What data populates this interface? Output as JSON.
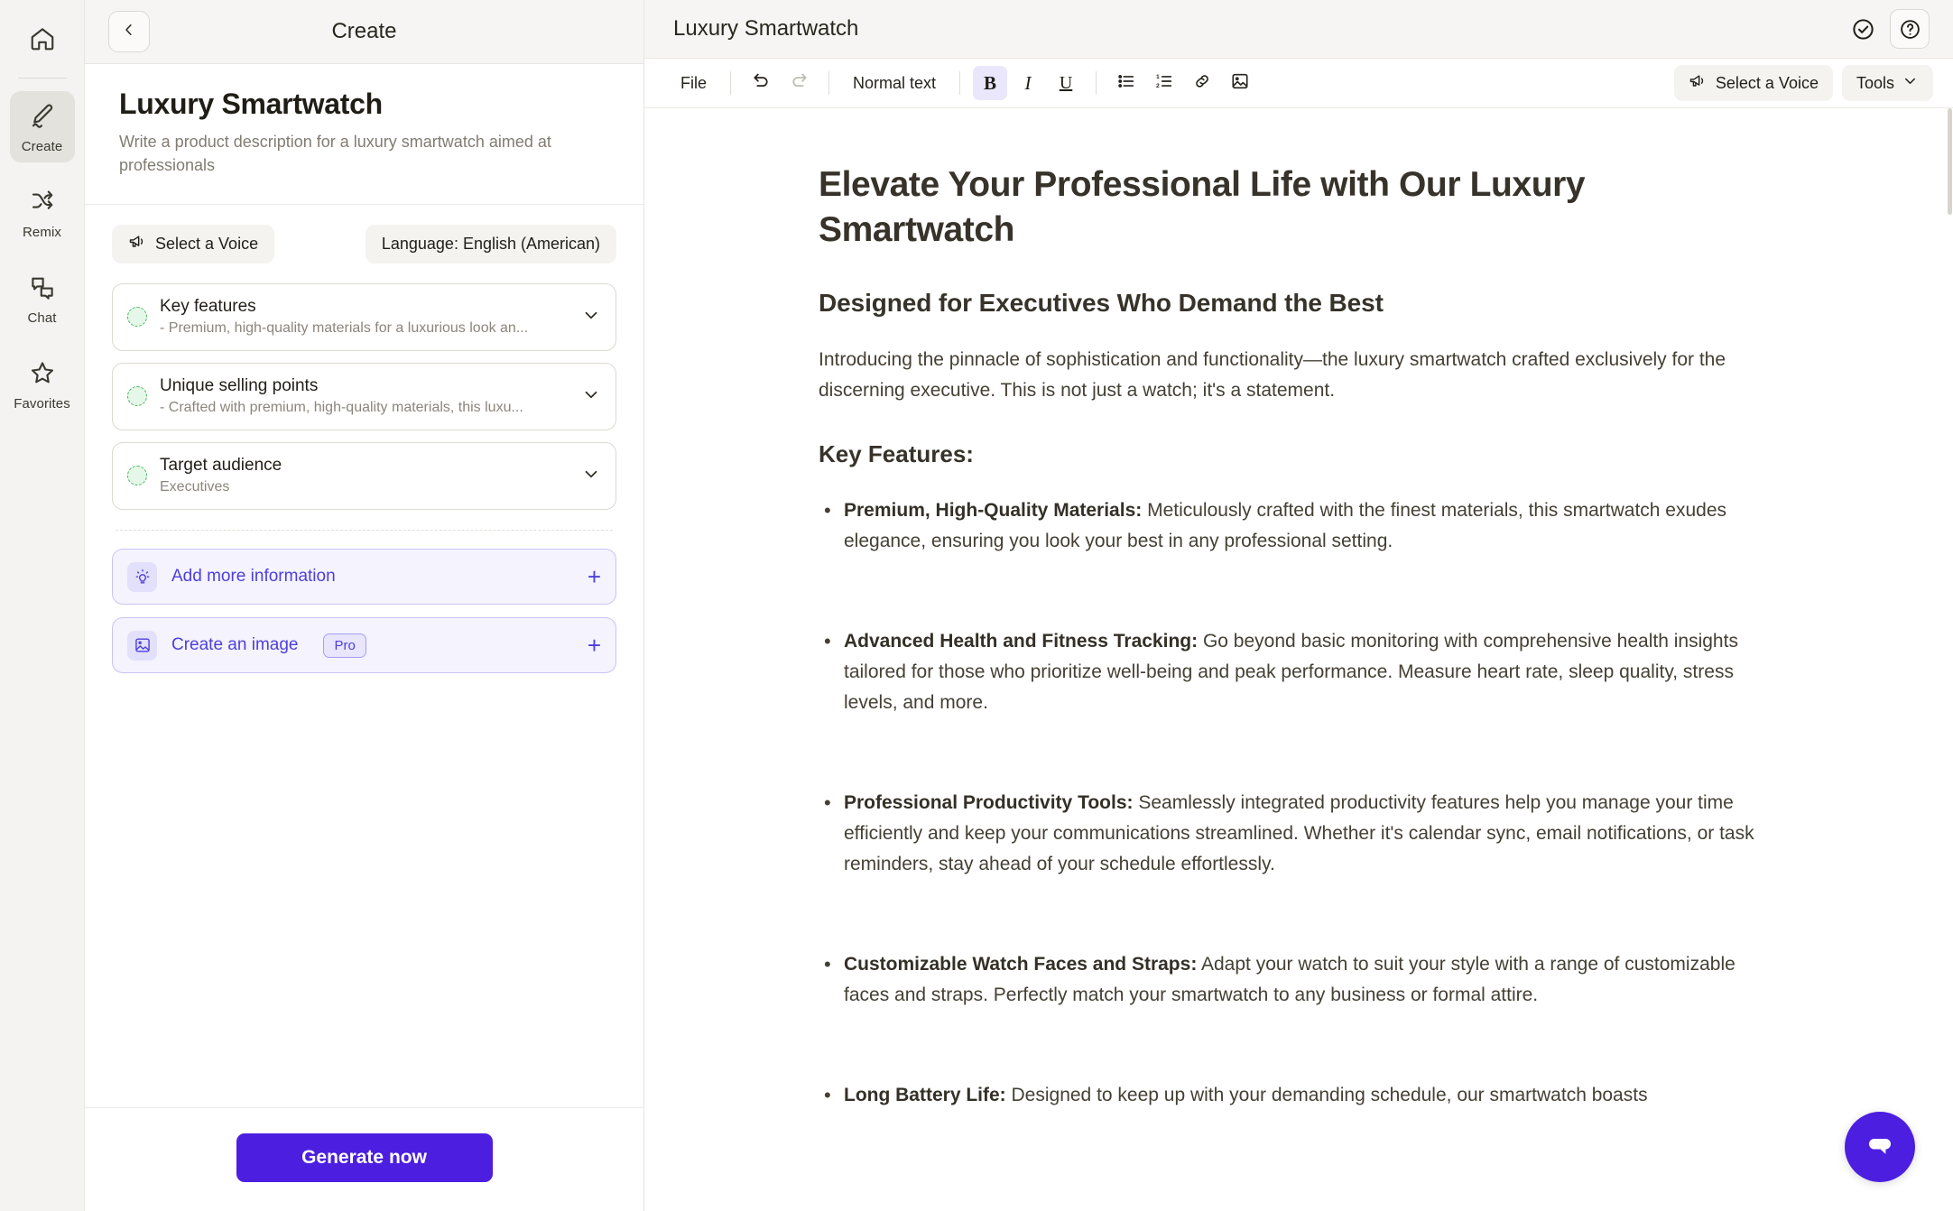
{
  "rail": {
    "home_icon": "home-icon",
    "items": [
      {
        "label": "Create",
        "icon": "pencil-icon",
        "active": true
      },
      {
        "label": "Remix",
        "icon": "shuffle-icon",
        "active": false
      },
      {
        "label": "Chat",
        "icon": "chat-bubbles-icon",
        "active": false
      },
      {
        "label": "Favorites",
        "icon": "star-icon",
        "active": false
      }
    ]
  },
  "panel": {
    "header_title": "Create",
    "back_icon": "chevron-left-icon",
    "title": "Luxury Smartwatch",
    "subtitle": "Write a product description for a luxury smartwatch aimed at professionals",
    "voice_chip": "Select a Voice",
    "voice_icon": "megaphone-icon",
    "language_chip": "Language: English (American)",
    "accordions": [
      {
        "title": "Key features",
        "desc": "- Premium, high-quality materials for a luxurious look an...",
        "chevron": "chevron-down-icon"
      },
      {
        "title": "Unique selling points",
        "desc": "- Crafted with premium, high-quality materials, this luxu...",
        "chevron": "chevron-down-icon"
      },
      {
        "title": "Target audience",
        "desc": "Executives",
        "chevron": "chevron-down-icon"
      }
    ],
    "add_info": {
      "label": "Add more information",
      "icon": "lightbulb-icon",
      "plus": "+"
    },
    "create_image": {
      "label": "Create an image",
      "badge": "Pro",
      "icon": "image-icon",
      "plus": "+"
    },
    "generate_button": "Generate now"
  },
  "editor": {
    "title": "Luxury Smartwatch",
    "header_icons": [
      {
        "name": "check-circle-icon"
      },
      {
        "name": "help-circle-icon"
      }
    ],
    "toolbar": {
      "file": "File",
      "undo_icon": "undo-icon",
      "redo_icon": "redo-icon",
      "style_label": "Normal text",
      "bold": "B",
      "italic": "I",
      "underline": "U",
      "bullet_list_icon": "bullet-list-icon",
      "numbered_list_icon": "numbered-list-icon",
      "link_icon": "link-icon",
      "image_icon": "image-icon",
      "voice_chip": "Select a Voice",
      "voice_icon": "megaphone-icon",
      "tools_label": "Tools",
      "tools_chevron": "chevron-down-icon"
    },
    "document": {
      "h1": "Elevate Your Professional Life with Our Luxury Smartwatch",
      "h2": "Designed for Executives Who Demand the Best",
      "intro": "Introducing the pinnacle of sophistication and functionality—the luxury smartwatch crafted exclusively for the discerning executive. This is not just a watch; it's a statement.",
      "h3": "Key Features:",
      "bullets": [
        {
          "lead": "Premium, High-Quality Materials:",
          "body": " Meticulously crafted with the finest materials, this smartwatch exudes elegance, ensuring you look your best in any professional setting."
        },
        {
          "lead": "Advanced Health and Fitness Tracking:",
          "body": " Go beyond basic monitoring with comprehensive health insights tailored for those who prioritize well-being and peak performance. Measure heart rate, sleep quality, stress levels, and more."
        },
        {
          "lead": "Professional Productivity Tools:",
          "body": " Seamlessly integrated productivity features help you manage your time efficiently and keep your communications streamlined. Whether it's calendar sync, email notifications, or task reminders, stay ahead of your schedule effortlessly."
        },
        {
          "lead": "Customizable Watch Faces and Straps:",
          "body": " Adapt your watch to suit your style with a range of customizable faces and straps. Perfectly match your smartwatch to any business or formal attire."
        },
        {
          "lead": "Long Battery Life:",
          "body": " Designed to keep up with your demanding schedule, our smartwatch boasts"
        }
      ]
    },
    "chat_fab_icon": "chat-bubble-icon"
  },
  "colors": {
    "accent": "#4c1fe0",
    "accent_soft_bg": "#f4f3fe",
    "accent_border": "#c9c4f5",
    "rail_bg": "#f4f3f1",
    "status_green": "#46b45f",
    "text_primary": "#211e17",
    "text_muted": "#8b867c"
  }
}
